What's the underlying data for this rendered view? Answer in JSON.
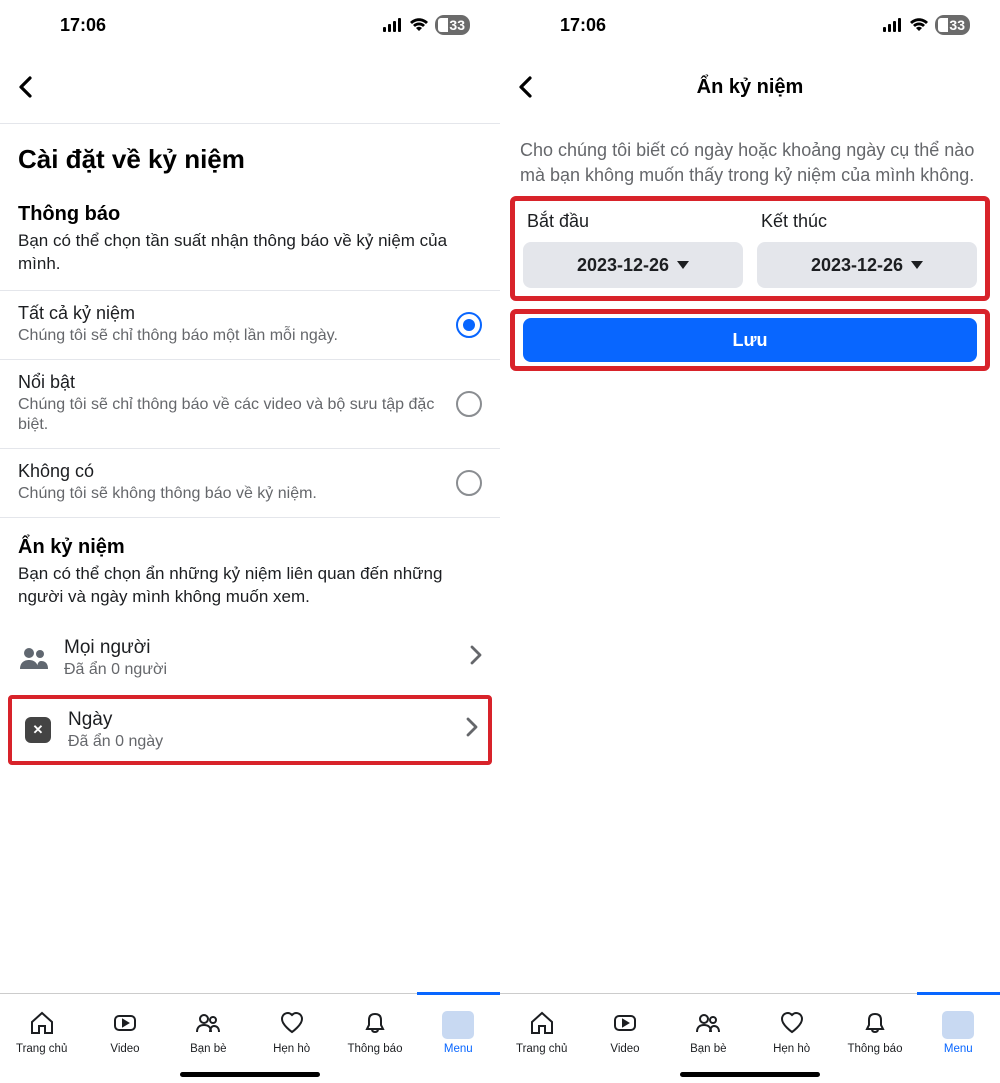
{
  "status": {
    "time": "17:06",
    "battery": "33"
  },
  "screen1": {
    "pageTitle": "Cài đặt về kỷ niệm",
    "notifTitle": "Thông báo",
    "notifDesc": "Bạn có thể chọn tần suất nhận thông báo về kỷ niệm của mình.",
    "radios": [
      {
        "label": "Tất cả kỷ niệm",
        "sub": "Chúng tôi sẽ chỉ thông báo một lần mỗi ngày.",
        "selected": true
      },
      {
        "label": "Nổi bật",
        "sub": "Chúng tôi sẽ chỉ thông báo về các video và bộ sưu tập đặc biệt.",
        "selected": false
      },
      {
        "label": "Không có",
        "sub": "Chúng tôi sẽ không thông báo về kỷ niệm.",
        "selected": false
      }
    ],
    "hideTitle": "Ẩn kỷ niệm",
    "hideDesc": "Bạn có thể chọn ẩn những kỷ niệm liên quan đến những người và ngày mình không muốn xem.",
    "people": {
      "label": "Mọi người",
      "sub": "Đã ẩn 0 người"
    },
    "days": {
      "label": "Ngày",
      "sub": "Đã ẩn 0 ngày"
    }
  },
  "screen2": {
    "navTitle": "Ẩn kỷ niệm",
    "desc": "Cho chúng tôi biết có ngày hoặc khoảng ngày cụ thể nào mà bạn không muốn thấy trong kỷ niệm của mình không.",
    "startLabel": "Bắt đầu",
    "endLabel": "Kết thúc",
    "startDate": "2023-12-26",
    "endDate": "2023-12-26",
    "saveLabel": "Lưu"
  },
  "tabs": [
    {
      "label": "Trang chủ",
      "icon": "home"
    },
    {
      "label": "Video",
      "icon": "video"
    },
    {
      "label": "Bạn bè",
      "icon": "friends"
    },
    {
      "label": "Hẹn hò",
      "icon": "dating"
    },
    {
      "label": "Thông báo",
      "icon": "bell"
    },
    {
      "label": "Menu",
      "icon": "menu",
      "active": true
    }
  ]
}
